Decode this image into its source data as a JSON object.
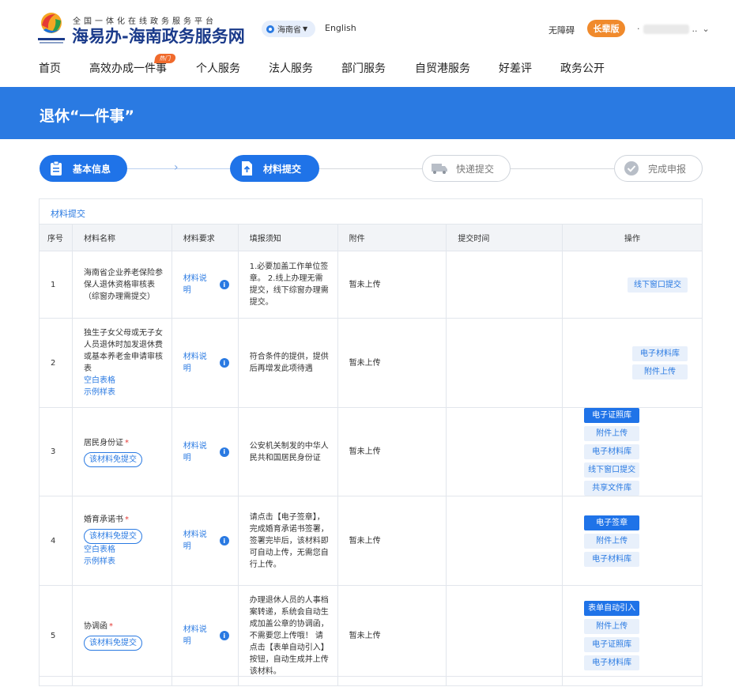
{
  "header": {
    "logo_subtitle": "全国一体化在线政务服务平台",
    "logo_title": "海易办-海南政务服务网",
    "region": "海南省",
    "language": "English",
    "accessibility": "无障碍",
    "elder_mode": "长辈版",
    "user_suffix": "· .."
  },
  "nav": {
    "items": [
      "首页",
      "高效办成一件事",
      "个人服务",
      "法人服务",
      "部门服务",
      "自贸港服务",
      "好差评",
      "政务公开"
    ],
    "hot_badge": "热门"
  },
  "banner": {
    "title": "退休“一件事”"
  },
  "steps": [
    {
      "label": "基本信息",
      "state": "done",
      "icon": "clipboard-icon"
    },
    {
      "label": "材料提交",
      "state": "active",
      "icon": "upload-icon"
    },
    {
      "label": "快递提交",
      "state": "pending",
      "icon": "truck-icon"
    },
    {
      "label": "完成申报",
      "state": "pending",
      "icon": "check-circle-icon"
    }
  ],
  "section": {
    "title": "材料提交",
    "columns": [
      "序号",
      "材料名称",
      "材料要求",
      "填报须知",
      "附件",
      "提交时间",
      "操作"
    ],
    "rows": [
      {
        "index": "1",
        "name": "海南省企业养老保险参保人退休资格审核表（综窗办理需提交）",
        "requirement": "材料说明",
        "notice": "1.必要加盖工作单位签章。 2.线上办理无需提交，线下综窗办理需提交。",
        "attachment": "暂未上传",
        "time": "",
        "actions": [
          "线下窗口提交"
        ]
      },
      {
        "index": "2",
        "name": "独生子女父母或无子女人员退休时加发退休费或基本养老金申请审核表",
        "blank_form": "空白表格",
        "sample_form": "示例样表",
        "requirement": "材料说明",
        "notice": "符合条件的提供，提供后再增发此项待遇",
        "attachment": "暂未上传",
        "time": "",
        "actions": [
          "电子材料库",
          "附件上传"
        ]
      },
      {
        "index": "3",
        "name": "居民身份证",
        "required_mark": "*",
        "free_tag": "该材料免提交",
        "requirement": "材料说明",
        "notice": "公安机关制发的中华人民共和国居民身份证",
        "attachment": "暂未上传",
        "time": "",
        "actions": [
          "电子证照库",
          "附件上传",
          "电子材料库",
          "线下窗口提交",
          "共享文件库"
        ]
      },
      {
        "index": "4",
        "name": "婚育承诺书",
        "required_mark": "*",
        "free_tag": "该材料免提交",
        "blank_form": "空白表格",
        "sample_form": "示例样表",
        "requirement": "材料说明",
        "notice": "请点击【电子签章】，完成婚育承诺书签署，签署完毕后，该材料即可自动上传，无需您自行上传。",
        "attachment": "暂未上传",
        "time": "",
        "actions": [
          "电子签章",
          "附件上传",
          "电子材料库"
        ]
      },
      {
        "index": "5",
        "name": "协调函",
        "required_mark": "*",
        "free_tag": "该材料免提交",
        "requirement": "材料说明",
        "notice": "办理退休人员的人事档案转递，系统会自动生成加盖公章的协调函，不需要您上传哦！ 请点击【表单自动引入】按钮，自动生成并上传该材料。",
        "attachment": "暂未上传",
        "time": "",
        "actions": [
          "表单自动引入",
          "附件上传",
          "电子证照库",
          "电子材料库"
        ]
      }
    ]
  },
  "colors": {
    "primary": "#1f73e8",
    "banner": "#2a7ae2",
    "elder": "#f08a2c",
    "required": "#e53935"
  }
}
